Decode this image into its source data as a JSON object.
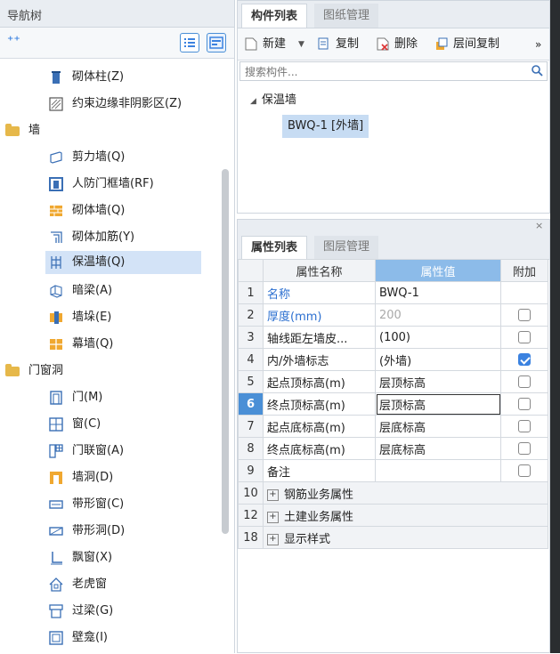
{
  "nav": {
    "title": "导航树",
    "tree": [
      {
        "label": "砌体柱(Z)",
        "icon": "masonry-column-icon",
        "level": 1
      },
      {
        "label": "约束边缘非阴影区(Z)",
        "icon": "constraint-edge-icon",
        "level": 1
      },
      {
        "label": "墙",
        "icon": "folder-icon",
        "level": 0
      },
      {
        "label": "剪力墙(Q)",
        "icon": "shear-wall-icon",
        "level": 1
      },
      {
        "label": "人防门框墙(RF)",
        "icon": "civil-defense-wall-icon",
        "level": 1
      },
      {
        "label": "砌体墙(Q)",
        "icon": "masonry-wall-icon",
        "level": 1
      },
      {
        "label": "砌体加筋(Y)",
        "icon": "masonry-rebar-icon",
        "level": 1
      },
      {
        "label": "保温墙(Q)",
        "icon": "insulation-wall-icon",
        "level": 1,
        "selected": true
      },
      {
        "label": "暗梁(A)",
        "icon": "hidden-beam-icon",
        "level": 1
      },
      {
        "label": "墙垛(E)",
        "icon": "wall-pier-icon",
        "level": 1
      },
      {
        "label": "幕墙(Q)",
        "icon": "curtain-wall-icon",
        "level": 1
      },
      {
        "label": "门窗洞",
        "icon": "folder-icon",
        "level": 0
      },
      {
        "label": "门(M)",
        "icon": "door-icon",
        "level": 1
      },
      {
        "label": "窗(C)",
        "icon": "window-icon",
        "level": 1
      },
      {
        "label": "门联窗(A)",
        "icon": "door-window-icon",
        "level": 1
      },
      {
        "label": "墙洞(D)",
        "icon": "wall-opening-icon",
        "level": 1
      },
      {
        "label": "带形窗(C)",
        "icon": "strip-window-icon",
        "level": 1
      },
      {
        "label": "带形洞(D)",
        "icon": "strip-opening-icon",
        "level": 1
      },
      {
        "label": "飘窗(X)",
        "icon": "bay-window-icon",
        "level": 1
      },
      {
        "label": "老虎窗",
        "icon": "dormer-icon",
        "level": 1
      },
      {
        "label": "过梁(G)",
        "icon": "lintel-icon",
        "level": 1
      },
      {
        "label": "壁龛(I)",
        "icon": "niche-icon",
        "level": 1
      }
    ]
  },
  "comp": {
    "tabs": [
      "构件列表",
      "图纸管理"
    ],
    "toolbar": {
      "new": "新建",
      "copy": "复制",
      "delete": "删除",
      "floor_copy": "层间复制",
      "more": "»"
    },
    "search_placeholder": "搜索构件...",
    "tree_root": "保温墙",
    "tree_item": "BWQ-1 [外墙]"
  },
  "props": {
    "close": "×",
    "tabs": [
      "属性列表",
      "图层管理"
    ],
    "headers": [
      "属性名称",
      "属性值",
      "附加"
    ],
    "rows": [
      {
        "num": "1",
        "name": "名称",
        "value": "BWQ-1",
        "blue": true
      },
      {
        "num": "2",
        "name": "厚度(mm)",
        "value": "200",
        "blue": true,
        "gray": true,
        "check": false
      },
      {
        "num": "3",
        "name": "轴线距左墙皮...",
        "value": "(100)",
        "check": false
      },
      {
        "num": "4",
        "name": "内/外墙标志",
        "value": "(外墙)",
        "check": true
      },
      {
        "num": "5",
        "name": "起点顶标高(m)",
        "value": "层顶标高",
        "check": false
      },
      {
        "num": "6",
        "name": "终点顶标高(m)",
        "value": "层顶标高",
        "check": false,
        "current": true
      },
      {
        "num": "7",
        "name": "起点底标高(m)",
        "value": "层底标高",
        "check": false
      },
      {
        "num": "8",
        "name": "终点底标高(m)",
        "value": "层底标高",
        "check": false
      },
      {
        "num": "9",
        "name": "备注",
        "value": "",
        "check": false
      }
    ],
    "groups": [
      {
        "num": "10",
        "label": "钢筋业务属性"
      },
      {
        "num": "12",
        "label": "土建业务属性"
      },
      {
        "num": "18",
        "label": "显示样式"
      }
    ]
  }
}
